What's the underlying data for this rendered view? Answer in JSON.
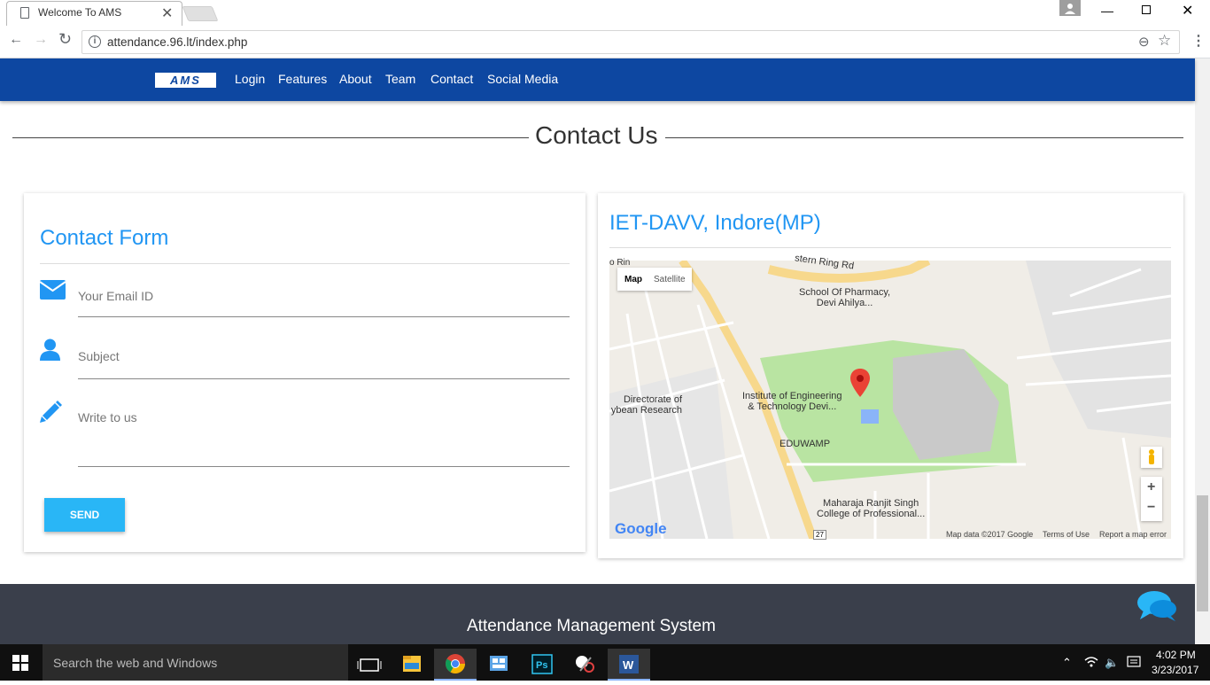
{
  "browser": {
    "tab_title": "Welcome To AMS",
    "tab_close": "✕",
    "url": "attendance.96.lt/index.php",
    "back": "←",
    "forward": "→",
    "reload": "↻",
    "info": "i",
    "zoom": "⊖",
    "star": "☆",
    "menu": "⋮",
    "window_min": "—",
    "window_close": "✕"
  },
  "navbar": {
    "logo": "AMS",
    "links": [
      "Login",
      "Features",
      "About",
      "Team",
      "Contact",
      "Social Media"
    ]
  },
  "section": {
    "title": "Contact Us"
  },
  "form": {
    "title": "Contact Form",
    "email_placeholder": "Your Email ID",
    "subject_placeholder": "Subject",
    "message_placeholder": "Write to us",
    "send_label": "SEND",
    "icons": [
      "envelope-icon",
      "user-icon",
      "pencil-icon"
    ]
  },
  "map": {
    "title": "IET-DAVV, Indore(MP)",
    "type_map": "Map",
    "type_satellite": "Satellite",
    "road_label": "stern Ring Rd",
    "road_label_2": "o Rin",
    "places": {
      "pharmacy_1": "School Of Pharmacy,",
      "pharmacy_2": "Devi Ahilya...",
      "institute_1": "Institute of Engineering",
      "institute_2": "& Technology Devi...",
      "directorate_1": "Directorate of",
      "directorate_2": "ybean Research",
      "eduwamp": "EDUWAMP",
      "maharaja_1": "Maharaja Ranjit Singh",
      "maharaja_2": "College of Professional..."
    },
    "highway_badge": "27",
    "zoom_in": "+",
    "zoom_out": "−",
    "logo": "Google",
    "attribution": {
      "data": "Map data ©2017 Google",
      "terms": "Terms of Use",
      "report": "Report a map error"
    },
    "colors": {
      "campus": "#b9e4a2",
      "highway": "#f7d88c",
      "pin": "#ea4335"
    }
  },
  "footer": {
    "title": "Attendance Management System"
  },
  "taskbar": {
    "search_placeholder": "Search the web and Windows",
    "apps": [
      "task-view-icon",
      "file-explorer-icon",
      "chrome-icon",
      "control-panel-icon",
      "photoshop-icon",
      "snipping-tool-icon",
      "word-icon"
    ],
    "ps_label": "Ps",
    "word_label": "W",
    "time": "4:02 PM",
    "date": "3/23/2017"
  }
}
